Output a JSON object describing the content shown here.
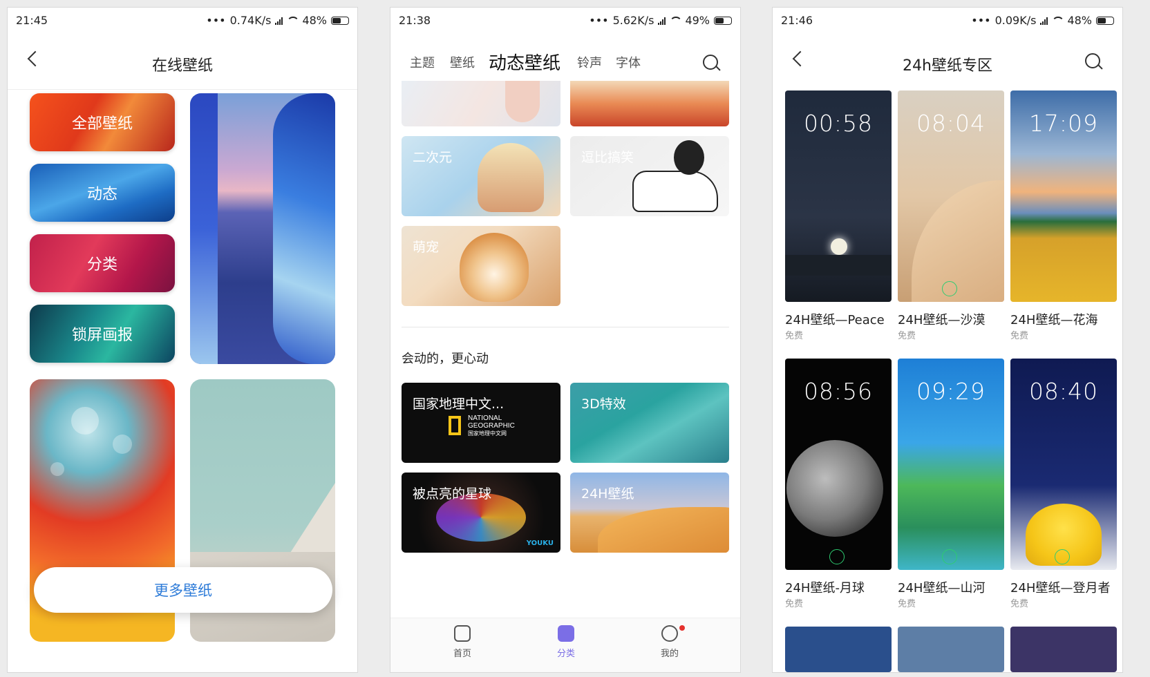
{
  "panel1": {
    "status": {
      "time": "21:45",
      "speed": "0.74K/s",
      "battery": "48%",
      "battery_level": 0.48
    },
    "title": "在线壁纸",
    "categories": [
      "全部壁纸",
      "动态",
      "分类",
      "锁屏画报"
    ],
    "more_button": "更多壁纸"
  },
  "panel2": {
    "status": {
      "time": "21:38",
      "speed": "5.62K/s",
      "battery": "49%",
      "battery_level": 0.49
    },
    "tabs": [
      "主题",
      "壁纸",
      "动态壁纸",
      "铃声",
      "字体"
    ],
    "active_tab": "动态壁纸",
    "categories": [
      "二次元",
      "逗比搞笑",
      "萌宠"
    ],
    "section_title": "会动的，更心动",
    "collections": [
      "国家地理中文...",
      "3D特效",
      "被点亮的星球",
      "24H壁纸"
    ],
    "natgeo_logo": [
      "NATIONAL",
      "GEOGRAPHIC",
      "国家地理中文网"
    ],
    "youku": "YOUKU",
    "bottom_nav": [
      "首页",
      "分类",
      "我的"
    ]
  },
  "panel3": {
    "status": {
      "time": "21:46",
      "speed": "0.09K/s",
      "battery": "48%",
      "battery_level": 0.48
    },
    "title": "24h壁纸专区",
    "wallpapers": [
      {
        "clock": "00:58",
        "name": "24H壁纸—Peace",
        "price": "免费"
      },
      {
        "clock": "08:04",
        "name": "24H壁纸—沙漠",
        "price": "免费"
      },
      {
        "clock": "17:09",
        "name": "24H壁纸—花海",
        "price": "免费"
      },
      {
        "clock": "08:56",
        "name": "24H壁纸-月球",
        "price": "免费"
      },
      {
        "clock": "09:29",
        "name": "24H壁纸—山河",
        "price": "免费"
      },
      {
        "clock": "08:40",
        "name": "24H壁纸—登月者",
        "price": "免费"
      }
    ]
  },
  "colors": {
    "accent_blue": "#2d7bd8",
    "tab_underline": "#f59a23",
    "bottom_active": "#7b6ee6",
    "badge_red": "#e5322e",
    "progress_green": "#2ecc71"
  },
  "icons": [
    "back-icon",
    "search-icon",
    "wifi-icon",
    "signal-icon",
    "battery-icon",
    "home-icon",
    "category-icon",
    "profile-icon"
  ]
}
